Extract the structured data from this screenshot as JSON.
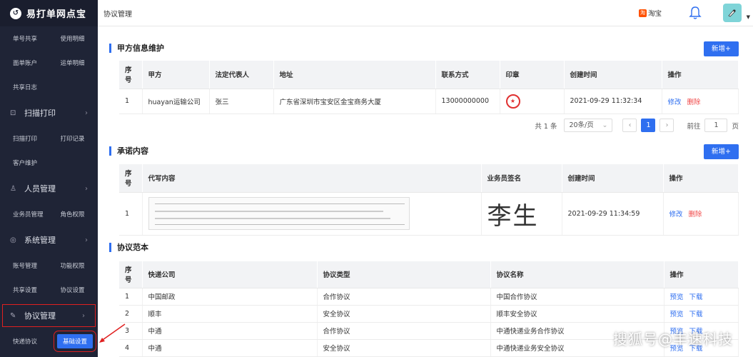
{
  "app": {
    "title": "易打单网点宝",
    "logo_icon": "logo-icon"
  },
  "sidebar": {
    "row1": [
      "单号共享",
      "使用明细"
    ],
    "row2": [
      "面单账户",
      "运单明细"
    ],
    "row3": [
      "共享日志"
    ],
    "group_scan": "扫描打印",
    "row4": [
      "扫描打印",
      "打印记录"
    ],
    "row5": [
      "客户维护"
    ],
    "group_staff": "人员管理",
    "row6": [
      "业务员管理",
      "角色权限"
    ],
    "group_system": "系统管理",
    "row7": [
      "账号管理",
      "功能权限"
    ],
    "row8": [
      "共享设置",
      "协议设置"
    ],
    "group_protocol": "协议管理",
    "row9_left": "快递协议",
    "row9_right": "基础设置"
  },
  "topbar": {
    "breadcrumb": "协议管理",
    "taobao_badge": "淘",
    "taobao": "淘宝"
  },
  "party": {
    "title": "甲方信息维护",
    "add_label": "新增+",
    "headers": [
      "序号",
      "甲方",
      "法定代表人",
      "地址",
      "联系方式",
      "印章",
      "创建时间",
      "操作"
    ],
    "rows": [
      {
        "seq": "1",
        "party": "huayan运输公司",
        "rep": "张三",
        "address": "广东省深圳市宝安区金宝商务大厦",
        "phone": "13000000000",
        "created": "2021-09-29 11:32:34",
        "edit": "修改",
        "delete": "删除"
      }
    ]
  },
  "pager": {
    "total": "共 1 条",
    "size": "20条/页",
    "prev": "‹",
    "current": "1",
    "next": "›",
    "goto_label": "前往",
    "goto_value": "1",
    "page_unit": "页"
  },
  "promise": {
    "title": "承诺内容",
    "add_label": "新增+",
    "headers": [
      "序号",
      "代写内容",
      "业务员签名",
      "创建时间",
      "操作"
    ],
    "rows": [
      {
        "seq": "1",
        "signature": "李生",
        "created": "2021-09-29 11:34:59",
        "edit": "修改",
        "delete": "删除"
      }
    ]
  },
  "templates": {
    "title": "协议范本",
    "headers": [
      "序号",
      "快递公司",
      "协议类型",
      "协议名称",
      "操作"
    ],
    "rows": [
      {
        "seq": "1",
        "company": "中国邮政",
        "type": "合作协议",
        "name": "中国合作协议",
        "preview": "预览",
        "download": "下载"
      },
      {
        "seq": "2",
        "company": "顺丰",
        "type": "安全协议",
        "name": "顺丰安全协议",
        "preview": "预览",
        "download": "下载"
      },
      {
        "seq": "3",
        "company": "中通",
        "type": "合作协议",
        "name": "中通快递业务合作协议",
        "preview": "预览",
        "download": "下载"
      },
      {
        "seq": "4",
        "company": "中通",
        "type": "安全协议",
        "name": "中通快递业务安全协议",
        "preview": "预览",
        "download": "下载"
      }
    ]
  },
  "watermark": "搜狐号@丰速科技"
}
